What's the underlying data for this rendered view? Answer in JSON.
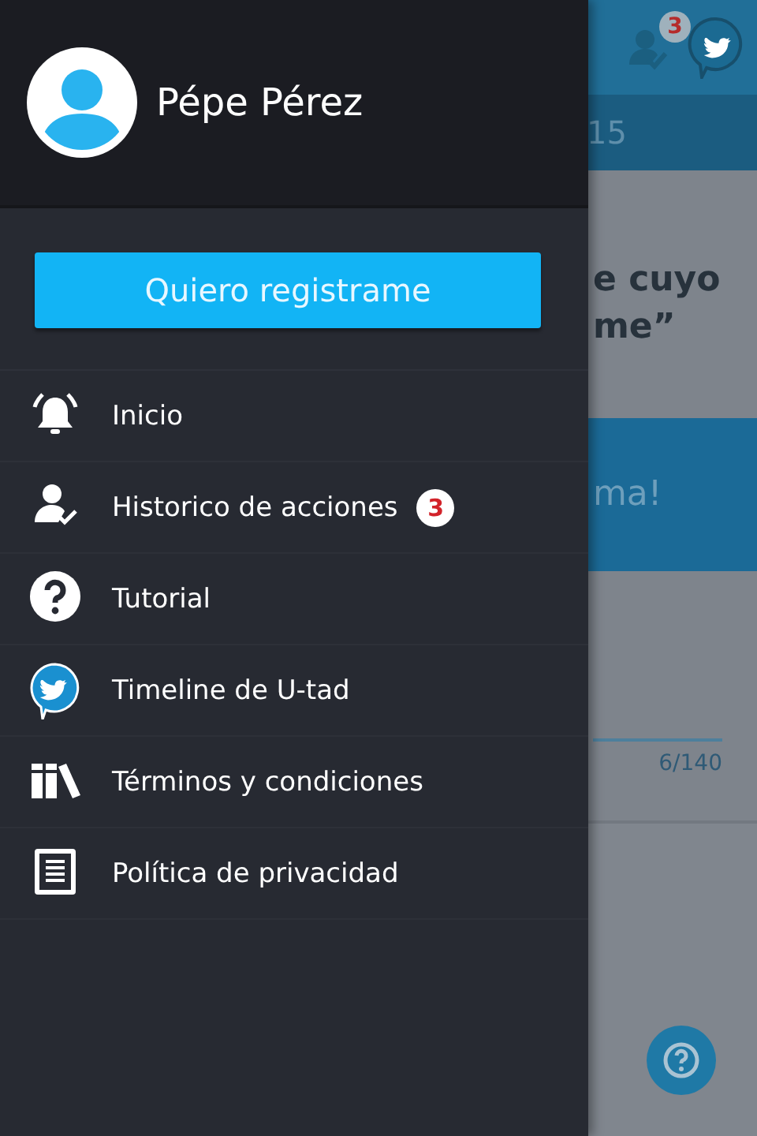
{
  "background": {
    "top_bar": {
      "notification_count": "3"
    },
    "sub_bar": {
      "text": "15"
    },
    "heading_lines": [
      "e cuyo",
      "me”"
    ],
    "banner": {
      "text": "ma!"
    },
    "char_count": "6/140"
  },
  "drawer": {
    "user_name": "Pépe Pérez",
    "register_button": "Quiero registrame",
    "menu": [
      {
        "label": "Inicio"
      },
      {
        "label": "Historico de acciones",
        "badge": "3"
      },
      {
        "label": "Tutorial"
      },
      {
        "label": "Timeline de U-tad"
      },
      {
        "label": "Términos y condiciones"
      },
      {
        "label": "Política de privacidad"
      }
    ]
  }
}
